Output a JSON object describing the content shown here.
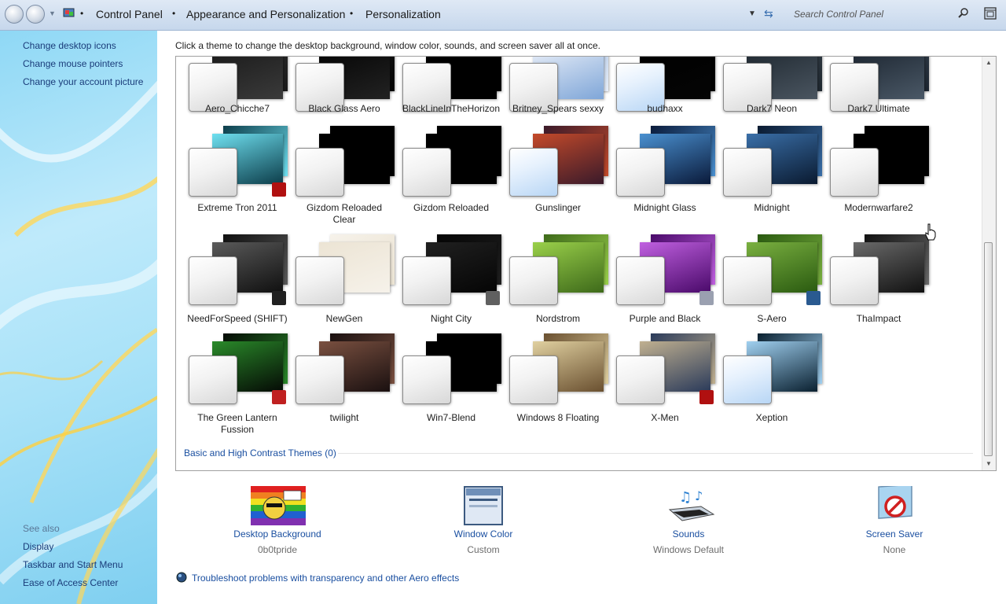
{
  "window": {
    "breadcrumb": [
      "Control Panel",
      "Appearance and Personalization",
      "Personalization"
    ],
    "search_placeholder": "Search Control Panel"
  },
  "left_pane": {
    "tasks": [
      "Change desktop icons",
      "Change mouse pointers",
      "Change your account picture"
    ],
    "see_also_title": "See also",
    "see_also": [
      "Display",
      "Taskbar and Start Menu",
      "Ease of Access Center"
    ]
  },
  "description": "Click a theme to change the desktop background, window color, sounds, and screen saver all at once.",
  "themes": [
    {
      "name": "Aero_Chicche7",
      "wallpaper": "#3a3a3a",
      "wallpaper2": "#1a1a1a"
    },
    {
      "name": "Black Glass Aero",
      "wallpaper": "#222222",
      "wallpaper2": "#050505"
    },
    {
      "name": "BlackLineInTheHorizon",
      "wallpaper": "#000000",
      "wallpaper2": "#000000"
    },
    {
      "name": "Britney_Spears sexxy",
      "wallpaper": "#7fa6d8",
      "wallpaper2": "#e8eef8"
    },
    {
      "name": "budhaxx",
      "wallpaper": "#050505",
      "wallpaper2": "#000000"
    },
    {
      "name": "Dark7 Neon",
      "wallpaper": "#4a5560",
      "wallpaper2": "#1f2830"
    },
    {
      "name": "Dark7 Ultimate",
      "wallpaper": "#4a5866",
      "wallpaper2": "#1c2530"
    },
    {
      "name": "Extreme Tron 2011",
      "wallpaper": "#0c3d4a",
      "wallpaper2": "#6fe0f0"
    },
    {
      "name": "Gizdom Reloaded Clear",
      "wallpaper": "#000000",
      "wallpaper2": "#000000"
    },
    {
      "name": "Gizdom Reloaded",
      "wallpaper": "#000000",
      "wallpaper2": "#000000"
    },
    {
      "name": "Gunslinger",
      "wallpaper": "#3a1a2a",
      "wallpaper2": "#c44a2a"
    },
    {
      "name": "Midnight Glass",
      "wallpaper": "#0a1a3a",
      "wallpaper2": "#4a90d0"
    },
    {
      "name": "Midnight",
      "wallpaper": "#0a1a30",
      "wallpaper2": "#3a6fa8"
    },
    {
      "name": "Modernwarfare2",
      "wallpaper": "#000000",
      "wallpaper2": "#000000"
    },
    {
      "name": "NeedForSpeed (SHIFT)",
      "wallpaper": "#101010",
      "wallpaper2": "#5a5a5a"
    },
    {
      "name": "NewGen",
      "wallpaper": "#f6f2ea",
      "wallpaper2": "#ece4d4"
    },
    {
      "name": "Night City",
      "wallpaper": "#050505",
      "wallpaper2": "#202020"
    },
    {
      "name": "Nordstrom",
      "wallpaper": "#3e6a1a",
      "wallpaper2": "#9ad04a"
    },
    {
      "name": "Purple and Black",
      "wallpaper": "#4a0a6a",
      "wallpaper2": "#c060e0"
    },
    {
      "name": "S-Aero",
      "wallpaper": "#2a5a10",
      "wallpaper2": "#7ab040"
    },
    {
      "name": "ThaImpact",
      "wallpaper": "#111111",
      "wallpaper2": "#6a6a6a"
    },
    {
      "name": "The Green Lantern Fussion",
      "wallpaper": "#050a05",
      "wallpaper2": "#2a8a2a"
    },
    {
      "name": "twilight",
      "wallpaper": "#1a1010",
      "wallpaper2": "#7a5040"
    },
    {
      "name": "Win7-Blend",
      "wallpaper": "#000000",
      "wallpaper2": "#000000"
    },
    {
      "name": "Windows 8 Floating",
      "wallpaper": "#6a5030",
      "wallpaper2": "#e0d0a0"
    },
    {
      "name": "X-Men",
      "wallpaper": "#2a3a5a",
      "wallpaper2": "#c0b090"
    },
    {
      "name": "Xeption",
      "wallpaper": "#0a2030",
      "wallpaper2": "#a0d0f0"
    }
  ],
  "basic_themes_link": "Basic and High Contrast Themes (0)",
  "bottom_items": [
    {
      "label": "Desktop Background",
      "value": "0b0tpride"
    },
    {
      "label": "Window Color",
      "value": "Custom"
    },
    {
      "label": "Sounds",
      "value": "Windows Default"
    },
    {
      "label": "Screen Saver",
      "value": "None"
    }
  ],
  "troubleshoot_link": "Troubleshoot problems with transparency and other Aero effects",
  "colors": {
    "link": "#1a4fa0",
    "accent": "#3a6fb0"
  }
}
